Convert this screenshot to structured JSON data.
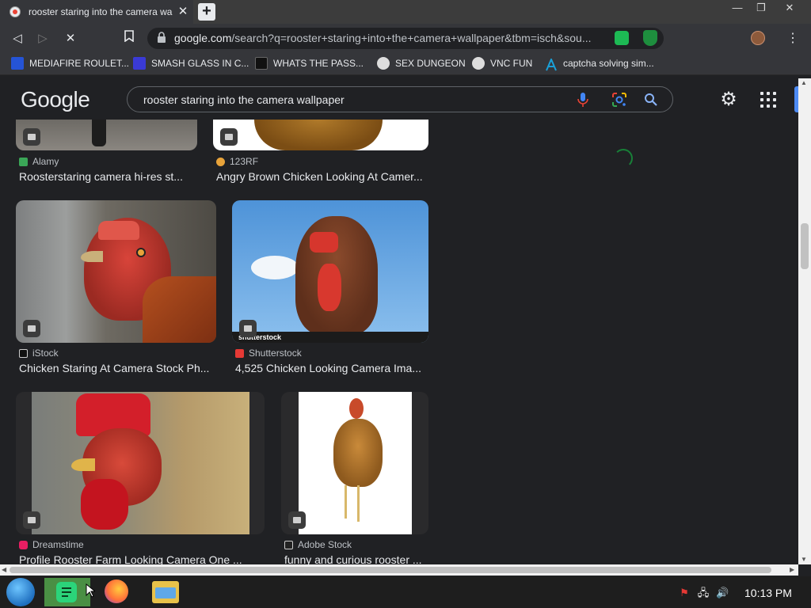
{
  "browser": {
    "tab_title": "rooster staring into the camera wa",
    "tab_close": "✕",
    "new_tab": "+",
    "window_controls": {
      "minimize": "—",
      "maximize": "❐",
      "close": "✕"
    },
    "url_host": "google.com",
    "url_rest": "/search?q=rooster+staring+into+the+camera+wallpaper&tbm=isch&sou...",
    "nav": {
      "back": "◁",
      "forward": "▷",
      "reload_stop": "✕",
      "bookmark": "🔖"
    },
    "menu": "⋮",
    "bookmarks": [
      {
        "label": "MEDIAFIRE ROULET...",
        "icon": "mediafire-icon",
        "color": "#2554d6"
      },
      {
        "label": "SMASH GLASS IN C...",
        "icon": "smash-glass-icon",
        "color": "#3a3ad6"
      },
      {
        "label": "WHATS THE PASS...",
        "icon": "password-icon",
        "color": "#111111"
      },
      {
        "label": "SEX DUNGEON",
        "icon": "dungeon-icon",
        "color": "#dddddd"
      },
      {
        "label": "VNC FUN",
        "icon": "vnc-icon",
        "color": "#dddddd"
      },
      {
        "label": "captcha solving sim...",
        "icon": "captcha-icon",
        "color": "#1aa0d8"
      }
    ]
  },
  "google": {
    "logo": "Google",
    "search_query": "rooster staring into the camera wallpaper",
    "settings_icon": "⚙"
  },
  "results": [
    {
      "source": "Alamy",
      "caption": "Roosterstaring camera hi-res st...",
      "icon_color": "#3aa657"
    },
    {
      "source": "123RF",
      "caption": "Angry Brown Chicken Looking At Camer...",
      "icon_color": "#e8a33a"
    },
    {
      "source": "iStock",
      "caption": "Chicken Staring At Camera Stock Ph...",
      "icon_color": "#111111"
    },
    {
      "source": "Shutterstock",
      "caption": "4,525 Chicken Looking Camera Ima...",
      "icon_color": "#e53935"
    },
    {
      "source": "Dreamstime",
      "caption": "Profile Rooster Farm Looking Camera One ...",
      "icon_color": "#e91e63"
    },
    {
      "source": "Adobe Stock",
      "caption": "funny and curious rooster ...",
      "icon_color": "#222222"
    }
  ],
  "shutterstock_watermark": "shutterstock",
  "taskbar": {
    "clock": "10:13 PM",
    "tray": {
      "flag": "⚑",
      "network": "🖧",
      "volume": "🔊"
    }
  }
}
